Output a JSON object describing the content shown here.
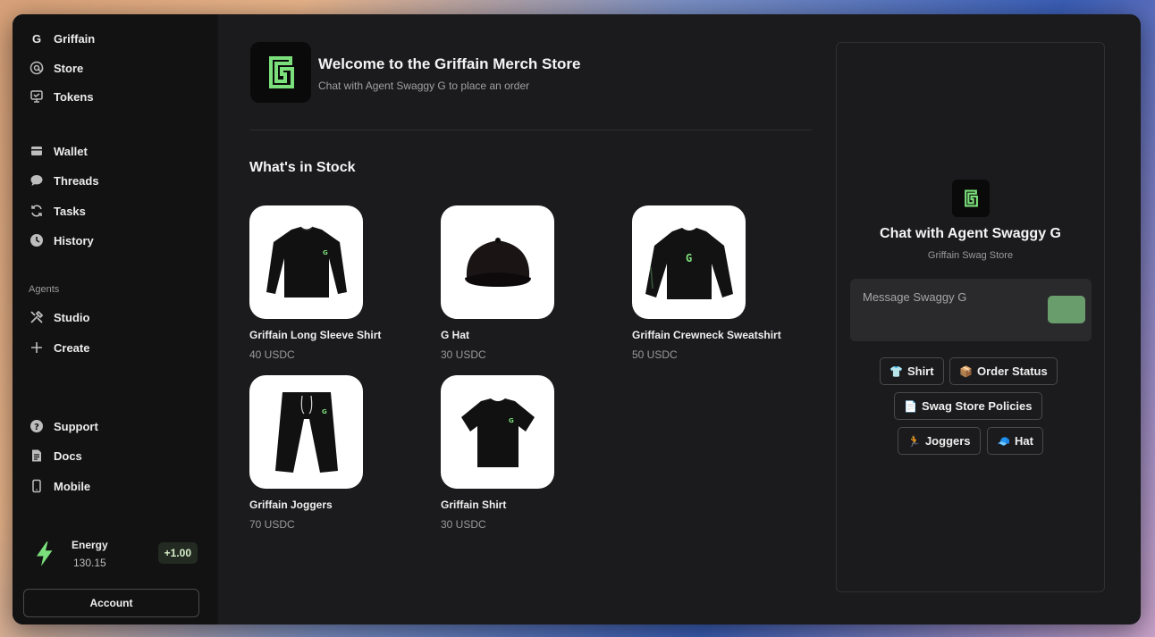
{
  "sidebar": {
    "app_name": "Griffain",
    "logo_letter": "G",
    "top_items": [
      {
        "label": "Store",
        "icon": "at-icon"
      },
      {
        "label": "Tokens",
        "icon": "tokens-icon"
      }
    ],
    "mid_items": [
      {
        "label": "Wallet",
        "icon": "wallet-icon"
      },
      {
        "label": "Threads",
        "icon": "chat-bubble-icon"
      },
      {
        "label": "Tasks",
        "icon": "refresh-icon"
      },
      {
        "label": "History",
        "icon": "clock-icon"
      }
    ],
    "agents_label": "Agents",
    "agent_items": [
      {
        "label": "Studio",
        "icon": "tools-icon"
      },
      {
        "label": "Create",
        "icon": "plus-icon"
      }
    ],
    "bottom_items": [
      {
        "label": "Support",
        "icon": "help-icon"
      },
      {
        "label": "Docs",
        "icon": "document-icon"
      },
      {
        "label": "Mobile",
        "icon": "mobile-icon"
      }
    ],
    "energy": {
      "label": "Energy",
      "value": "130.15",
      "delta": "+1.00"
    },
    "account_label": "Account",
    "accent_color": "#7be07b"
  },
  "main": {
    "logo_letter": "G",
    "title": "Welcome to the Griffain Merch Store",
    "subtitle": "Chat with Agent Swaggy G to place an order",
    "stock_title": "What's in Stock",
    "products": [
      {
        "name": "Griffain Long Sleeve Shirt",
        "price": "40 USDC",
        "icon": "long-sleeve-shirt-icon"
      },
      {
        "name": "G Hat",
        "price": "30 USDC",
        "icon": "cap-icon"
      },
      {
        "name": "Griffain Crewneck Sweatshirt",
        "price": "50 USDC",
        "icon": "sweatshirt-icon"
      },
      {
        "name": "Griffain Joggers",
        "price": "70 USDC",
        "icon": "joggers-icon"
      },
      {
        "name": "Griffain Shirt",
        "price": "30 USDC",
        "icon": "t-shirt-icon"
      }
    ]
  },
  "chat": {
    "logo_letter": "G",
    "title": "Chat with Agent Swaggy G",
    "subtitle": "Griffain Swag Store",
    "input_placeholder": "Message Swaggy G",
    "send_color": "#6a9d6c",
    "suggestions": [
      {
        "label": "Shirt",
        "emoji": "👕"
      },
      {
        "label": "Order Status",
        "emoji": "📦"
      },
      {
        "label": "Swag Store Policies",
        "emoji": "📄"
      },
      {
        "label": "Joggers",
        "emoji": "🏃"
      },
      {
        "label": "Hat",
        "emoji": "🧢"
      }
    ]
  }
}
